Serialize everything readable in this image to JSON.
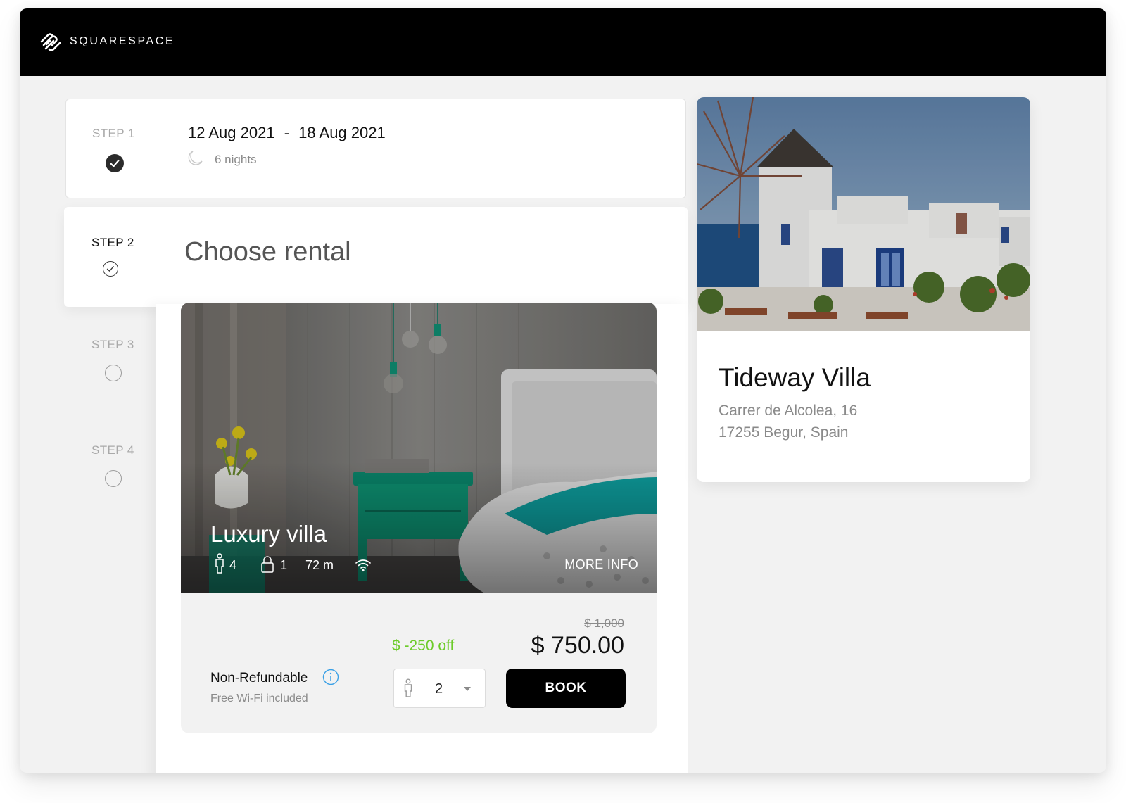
{
  "brand": {
    "name": "SQUARESPACE"
  },
  "steps": [
    {
      "label": "STEP 1",
      "state": "completed"
    },
    {
      "label": "STEP 2",
      "state": "current"
    },
    {
      "label": "STEP 3",
      "state": "pending"
    },
    {
      "label": "STEP 4",
      "state": "pending"
    }
  ],
  "step1": {
    "check_in": "12 Aug 2021",
    "separator": "-",
    "check_out": "18 Aug 2021",
    "nights": "6 nights"
  },
  "step2": {
    "title": "Choose rental"
  },
  "rental": {
    "name": "Luxury villa",
    "guests": "4",
    "rooms": "1",
    "area": "72 m",
    "more_info": "MORE INFO",
    "policy": "Non-Refundable",
    "amenity_note": "Free Wi-Fi included",
    "discount": "$ -250 off",
    "old_price": "$ 1,000",
    "price": "$ 750.00",
    "guest_count": "2",
    "book_label": "BOOK"
  },
  "villa": {
    "name": "Tideway Villa",
    "address_line1": "Carrer de Alcolea, 16",
    "address_line2": "17255 Begur, Spain"
  },
  "colors": {
    "accent_green": "#6ccb2a",
    "info_blue": "#3aa0e6",
    "topbar": "#000000"
  }
}
